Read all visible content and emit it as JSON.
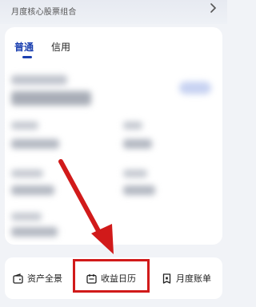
{
  "banner": {
    "text": "月度核心股票组合",
    "icon": "chevron-right-icon"
  },
  "tabs": [
    {
      "label": "普通",
      "active": true
    },
    {
      "label": "信用",
      "active": false
    }
  ],
  "bottom_entries": [
    {
      "label": "资产全景",
      "icon": "wallet-icon"
    },
    {
      "label": "收益日历",
      "icon": "calendar-icon"
    },
    {
      "label": "月度账单",
      "icon": "bill-icon"
    }
  ],
  "colors": {
    "accent": "#1a3fb0",
    "annotation": "#d11a1a"
  }
}
